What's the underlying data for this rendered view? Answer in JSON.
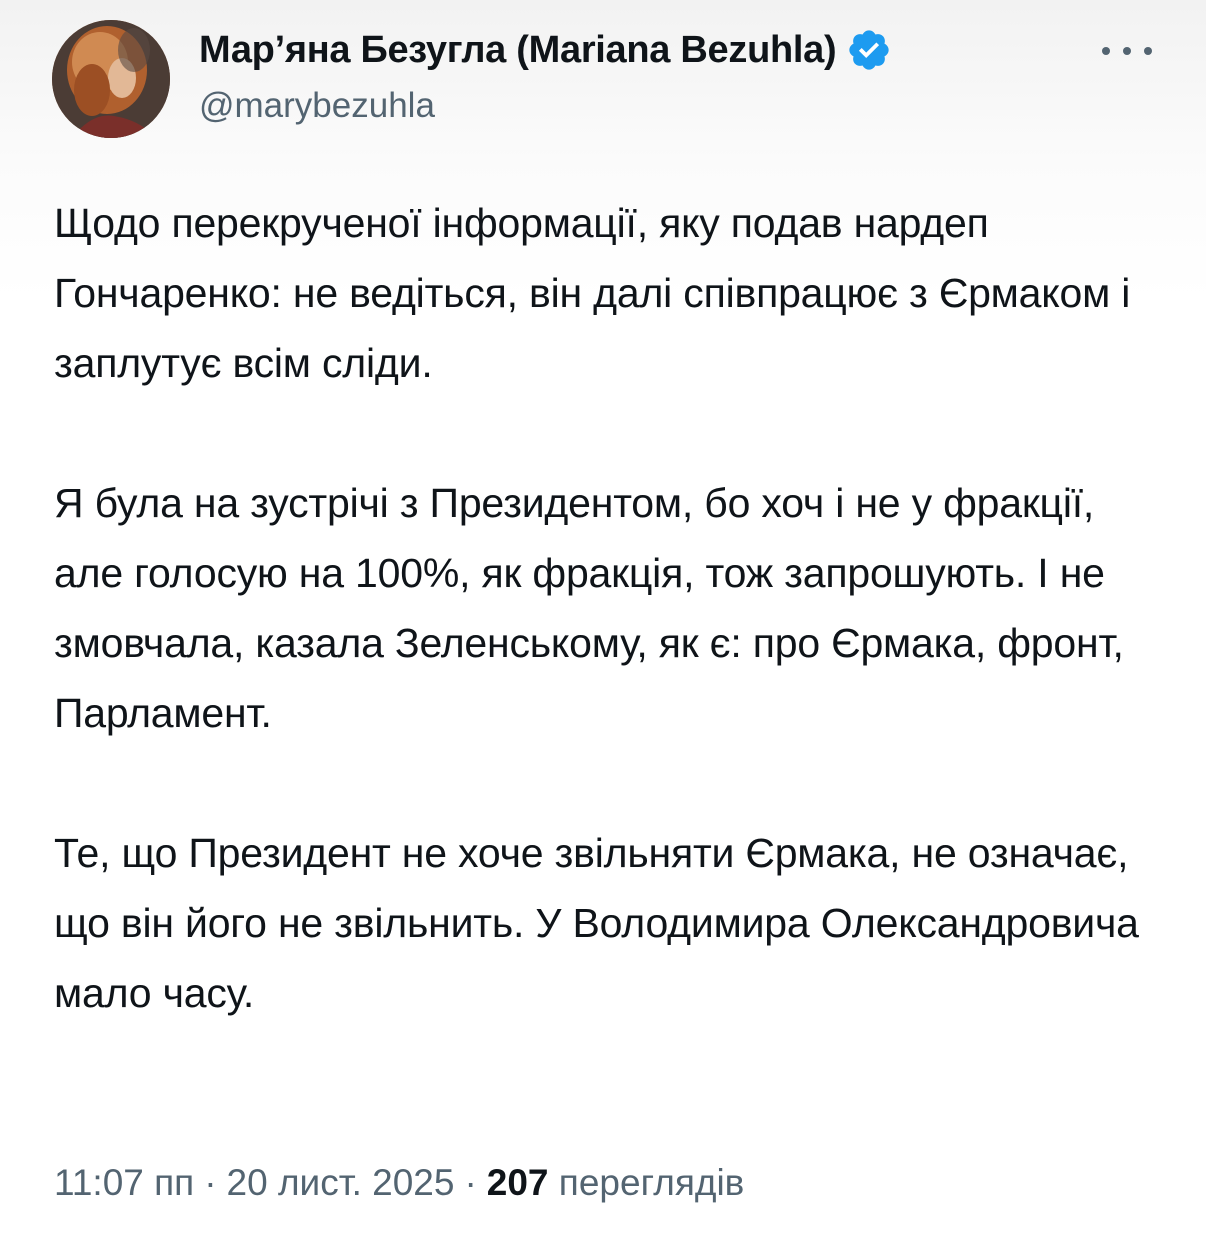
{
  "author": {
    "display_name": "Мар’яна Безугла (Mariana Bezuhla)",
    "handle": "@marybezuhla",
    "verified": true,
    "verified_color": "#1d9bf0"
  },
  "icons": {
    "verified": "verified-badge-icon",
    "more": "more-options-icon"
  },
  "tweet": {
    "paragraphs": [
      "Щодо перекрученої інформації, яку подав нардеп Гончаренко: не ведіться, він далі співпрацює з Єрмаком і заплутує всім сліди.",
      "Я була на зустрічі з Президентом, бо хоч і не у фракції, але голосую на 100%, як фракція, тож запрошують. І не змовчала, казала Зеленському, як є: про Єрмака, фронт, Парламент.",
      "Те, що Президент не хоче звільняти Єрмака, не означає, що він його не звільнить. У Володимира Олександровича мало часу."
    ]
  },
  "meta": {
    "time": "11:07 пп",
    "separator": "·",
    "date": "20 лист. 2025",
    "views_count": "207",
    "views_label": "переглядів"
  },
  "colors": {
    "text": "#0f1419",
    "secondary": "#536471",
    "accent": "#1d9bf0"
  }
}
